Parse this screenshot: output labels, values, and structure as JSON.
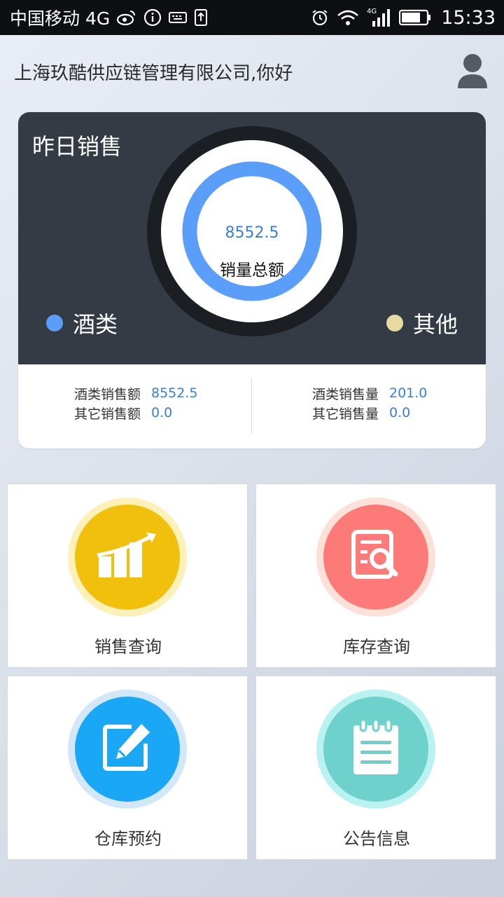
{
  "status_bar": {
    "carrier": "中国移动 4G",
    "time": "15:33",
    "icons": [
      "weibo-icon",
      "info-icon",
      "keyboard-icon",
      "upload-icon",
      "alarm-icon",
      "wifi-icon",
      "signal-4g-icon",
      "battery-icon"
    ]
  },
  "header": {
    "greeting": "上海玖酷供应链管理有限公司,你好",
    "avatar_icon": "user-avatar-icon"
  },
  "sales_card": {
    "title": "昨日销售",
    "total_value": "8552.5",
    "total_label": "销量总额",
    "legend": [
      {
        "label": "酒类",
        "color": "#5b9ef9"
      },
      {
        "label": "其他",
        "color": "#e8d9a0"
      }
    ],
    "stats_left": [
      {
        "label": "酒类销售额",
        "value": "8552.5"
      },
      {
        "label": "其它销售额",
        "value": "0.0"
      }
    ],
    "stats_right": [
      {
        "label": "酒类销售量",
        "value": "201.0"
      },
      {
        "label": "其它销售量",
        "value": "0.0"
      }
    ]
  },
  "tiles": [
    {
      "label": "销售查询",
      "icon": "sales-chart-icon",
      "color": "#f0c00c",
      "ring": "#fdf0b8"
    },
    {
      "label": "库存查询",
      "icon": "inventory-search-icon",
      "color": "#fc7a78",
      "ring": "#fde0d8"
    },
    {
      "label": "仓库预约",
      "icon": "edit-icon",
      "color": "#1aa7f6",
      "ring": "#d2e8f8"
    },
    {
      "label": "公告信息",
      "icon": "notepad-icon",
      "color": "#6fd1cc",
      "ring": "#b9f2f0"
    }
  ]
}
